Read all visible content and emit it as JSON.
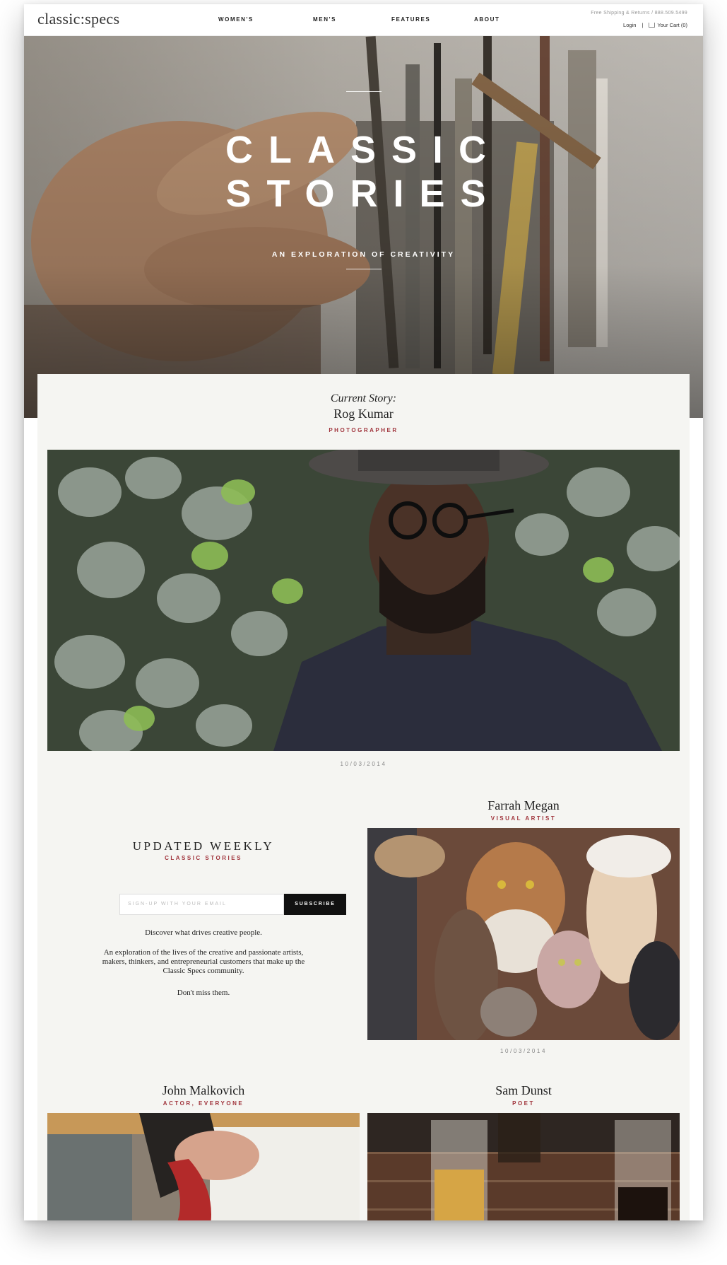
{
  "header": {
    "logo": "classic:specs",
    "nav": [
      "WOMEN'S",
      "MEN'S",
      "FEATURES",
      "ABOUT"
    ],
    "shipping": "Free Shipping & Returns / 888.509.5499",
    "login": "Login",
    "separator": "|",
    "cart": "Your Cart (0)"
  },
  "hero": {
    "title_line1": "CLASSIC",
    "title_line2": "STORIES",
    "subtitle": "AN EXPLORATION OF CREATIVITY"
  },
  "current_story": {
    "label": "Current Story:",
    "name": "Rog Kumar",
    "role": "PHOTOGRAPHER",
    "date": "10/03/2014"
  },
  "newsletter": {
    "title": "UPDATED WEEKLY",
    "subtitle": "CLASSIC STORIES",
    "email_placeholder": "SIGN-UP WITH YOUR EMAIL",
    "subscribe_label": "SUBSCRIBE",
    "line1": "Discover what drives creative people.",
    "line2": "An exploration of the lives of the creative and passionate artists, makers, thinkers, and entrepreneurial customers that make up the Classic Specs community.",
    "line3": "Don't miss them."
  },
  "stories": [
    {
      "name": "Farrah Megan",
      "role": "VISUAL ARTIST",
      "date": "10/03/2014"
    },
    {
      "name": "John Malkovich",
      "role": "ACTOR, EVERYONE"
    },
    {
      "name": "Sam Dunst",
      "role": "POET"
    }
  ],
  "colors": {
    "accent": "#a0343c",
    "panel": "#f5f5f2",
    "button": "#111111"
  }
}
